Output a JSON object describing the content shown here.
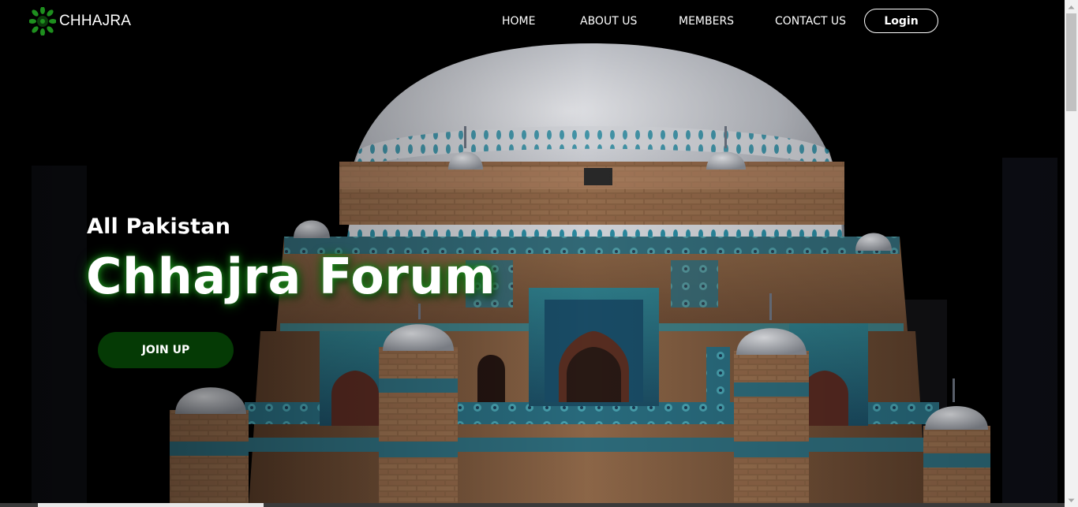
{
  "navbar": {
    "brand_name": "CHHAJRA",
    "links": [
      "HOME",
      "ABOUT US",
      "MEMBERS",
      "CONTACT US"
    ],
    "login_label": "Login"
  },
  "hero": {
    "subtitle": "All Pakistan",
    "title": "Chhajra Forum",
    "cta_label": "JOIN UP"
  },
  "colors": {
    "brand_green": "#1e8f1e",
    "cta_green": "#053a05",
    "background": "#000000"
  },
  "icons": {
    "brand": "leaf-wreath-logo-icon",
    "scroll_up": "arrow-up-icon",
    "scroll_down": "arrow-down-icon"
  }
}
